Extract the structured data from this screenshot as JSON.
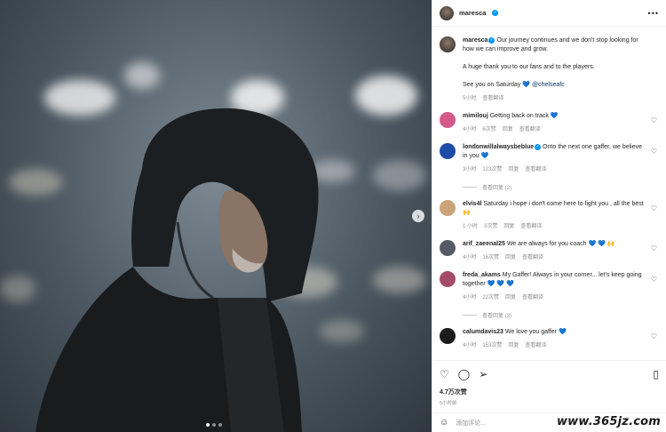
{
  "post": {
    "username": "maresca",
    "more_label": "•••",
    "image_alt": "Man in dark hooded rain jacket under stadium floodlights",
    "next_label": "›",
    "caption": {
      "line1": "Our journey continues and we don't stop looking for how we can improve and grow.",
      "line2": "A huge thank you to our fans and to the players.",
      "line3_prefix": "See you on Saturday",
      "line3_heart": "💙",
      "line3_mention": "@chelseafc",
      "time": "5小时",
      "translate": "查看翻译"
    }
  },
  "comments": [
    {
      "user": "mimilouj",
      "text": "Getting back on track",
      "heart": "💙",
      "time": "4小时",
      "likes": "6次赞",
      "reply": "回复",
      "translate": "查看翻译",
      "color": "#d35a8a"
    },
    {
      "user": "londonwillalwaysbeblue",
      "text": "Onto the next one gaffer, we believe in you",
      "heart": "💙",
      "time": "3小时",
      "likes": "123次赞",
      "reply": "回复",
      "translate": "查看翻译",
      "view_replies": "查看回复 (2)",
      "color": "#1e4aa8"
    },
    {
      "user": "elvis4l",
      "text": "Saturday i hope i don't come here to fight you , all the best",
      "heart": "🙌",
      "time": "1 小时",
      "likes": "3次赞",
      "reply": "回复",
      "translate": "查看翻译",
      "color": "#c9a37a"
    },
    {
      "user": "arif_zaeenal25",
      "text": "We are always for you coach",
      "heart": "💙 💙 🙌",
      "time": "4小时",
      "likes": "16次赞",
      "reply": "回复",
      "translate": "查看翻译",
      "color": "#555b66"
    },
    {
      "user": "freda_akams",
      "text": "My Gaffer! Always in your corner... let's keep going together",
      "heart": "💙 💙 💙",
      "time": "4小时",
      "likes": "22次赞",
      "reply": "回复",
      "translate": "查看翻译",
      "view_replies": "查看回复 (3)",
      "color": "#a64a6a"
    },
    {
      "user": "calumdavis23",
      "text": "We love you gaffer",
      "heart": "💙",
      "time": "4小时",
      "likes": "153次赞",
      "reply": "回复",
      "translate": "查看翻译",
      "color": "#1b1b1b"
    }
  ],
  "actions": {
    "like_icon": "heart-icon",
    "comment_icon": "comment-icon",
    "share_icon": "share-icon",
    "save_icon": "bookmark-icon",
    "likes_count": "4.7万次赞",
    "post_time": "5小时前"
  },
  "add_comment": {
    "placeholder": "添加评论..."
  },
  "watermark": "www.365jz.com",
  "colors": {
    "verified": "#0095f6",
    "link": "#00376b",
    "muted": "#8e8e8e"
  }
}
